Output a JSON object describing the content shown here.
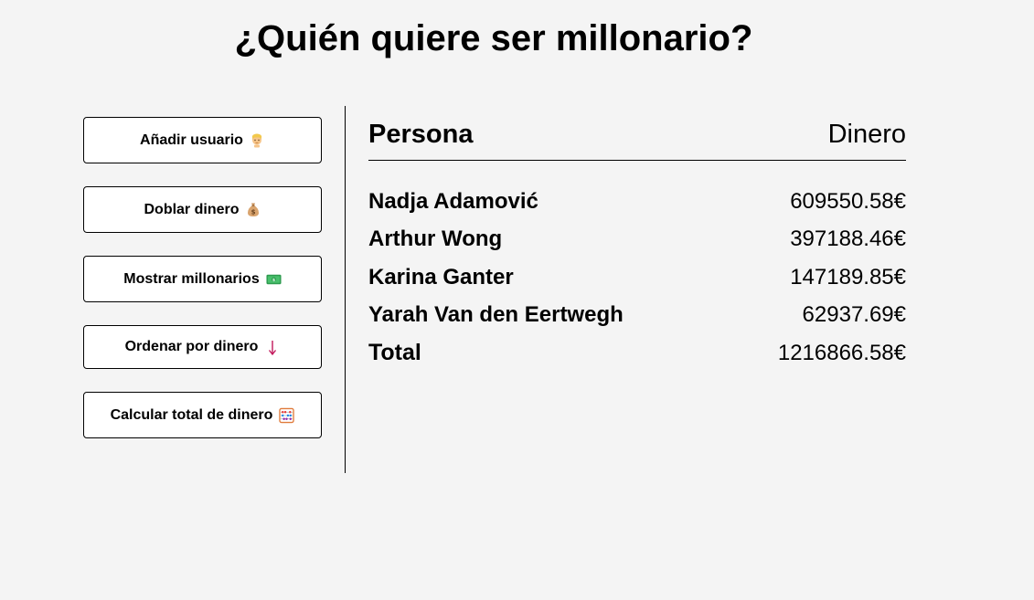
{
  "page": {
    "title": "¿Quién quiere ser millonario?"
  },
  "sidebar": {
    "buttons": [
      {
        "label": "Añadir usuario",
        "icon": "person-emoji-icon"
      },
      {
        "label": "Doblar dinero",
        "icon": "money-bag-icon"
      },
      {
        "label": "Mostrar millonarios",
        "icon": "banknote-icon"
      },
      {
        "label": "Ordenar por dinero",
        "icon": "arrow-down-icon",
        "icon_glyph": "↓"
      },
      {
        "label": "Calcular total de dinero",
        "icon": "abacus-icon"
      }
    ]
  },
  "table": {
    "header": {
      "person": "Persona",
      "money": "Dinero"
    },
    "rows": [
      {
        "name": "Nadja Adamović",
        "money": "609550.58€"
      },
      {
        "name": "Arthur Wong",
        "money": "397188.46€"
      },
      {
        "name": "Karina Ganter",
        "money": "147189.85€"
      },
      {
        "name": "Yarah Van den Eertwegh",
        "money": "62937.69€"
      }
    ],
    "total": {
      "label": "Total",
      "money": "1216866.58€"
    }
  },
  "colors": {
    "background": "#f4f4f4",
    "button_background": "#ffffff",
    "text": "#000000",
    "arrow_accent": "#c2185b"
  }
}
